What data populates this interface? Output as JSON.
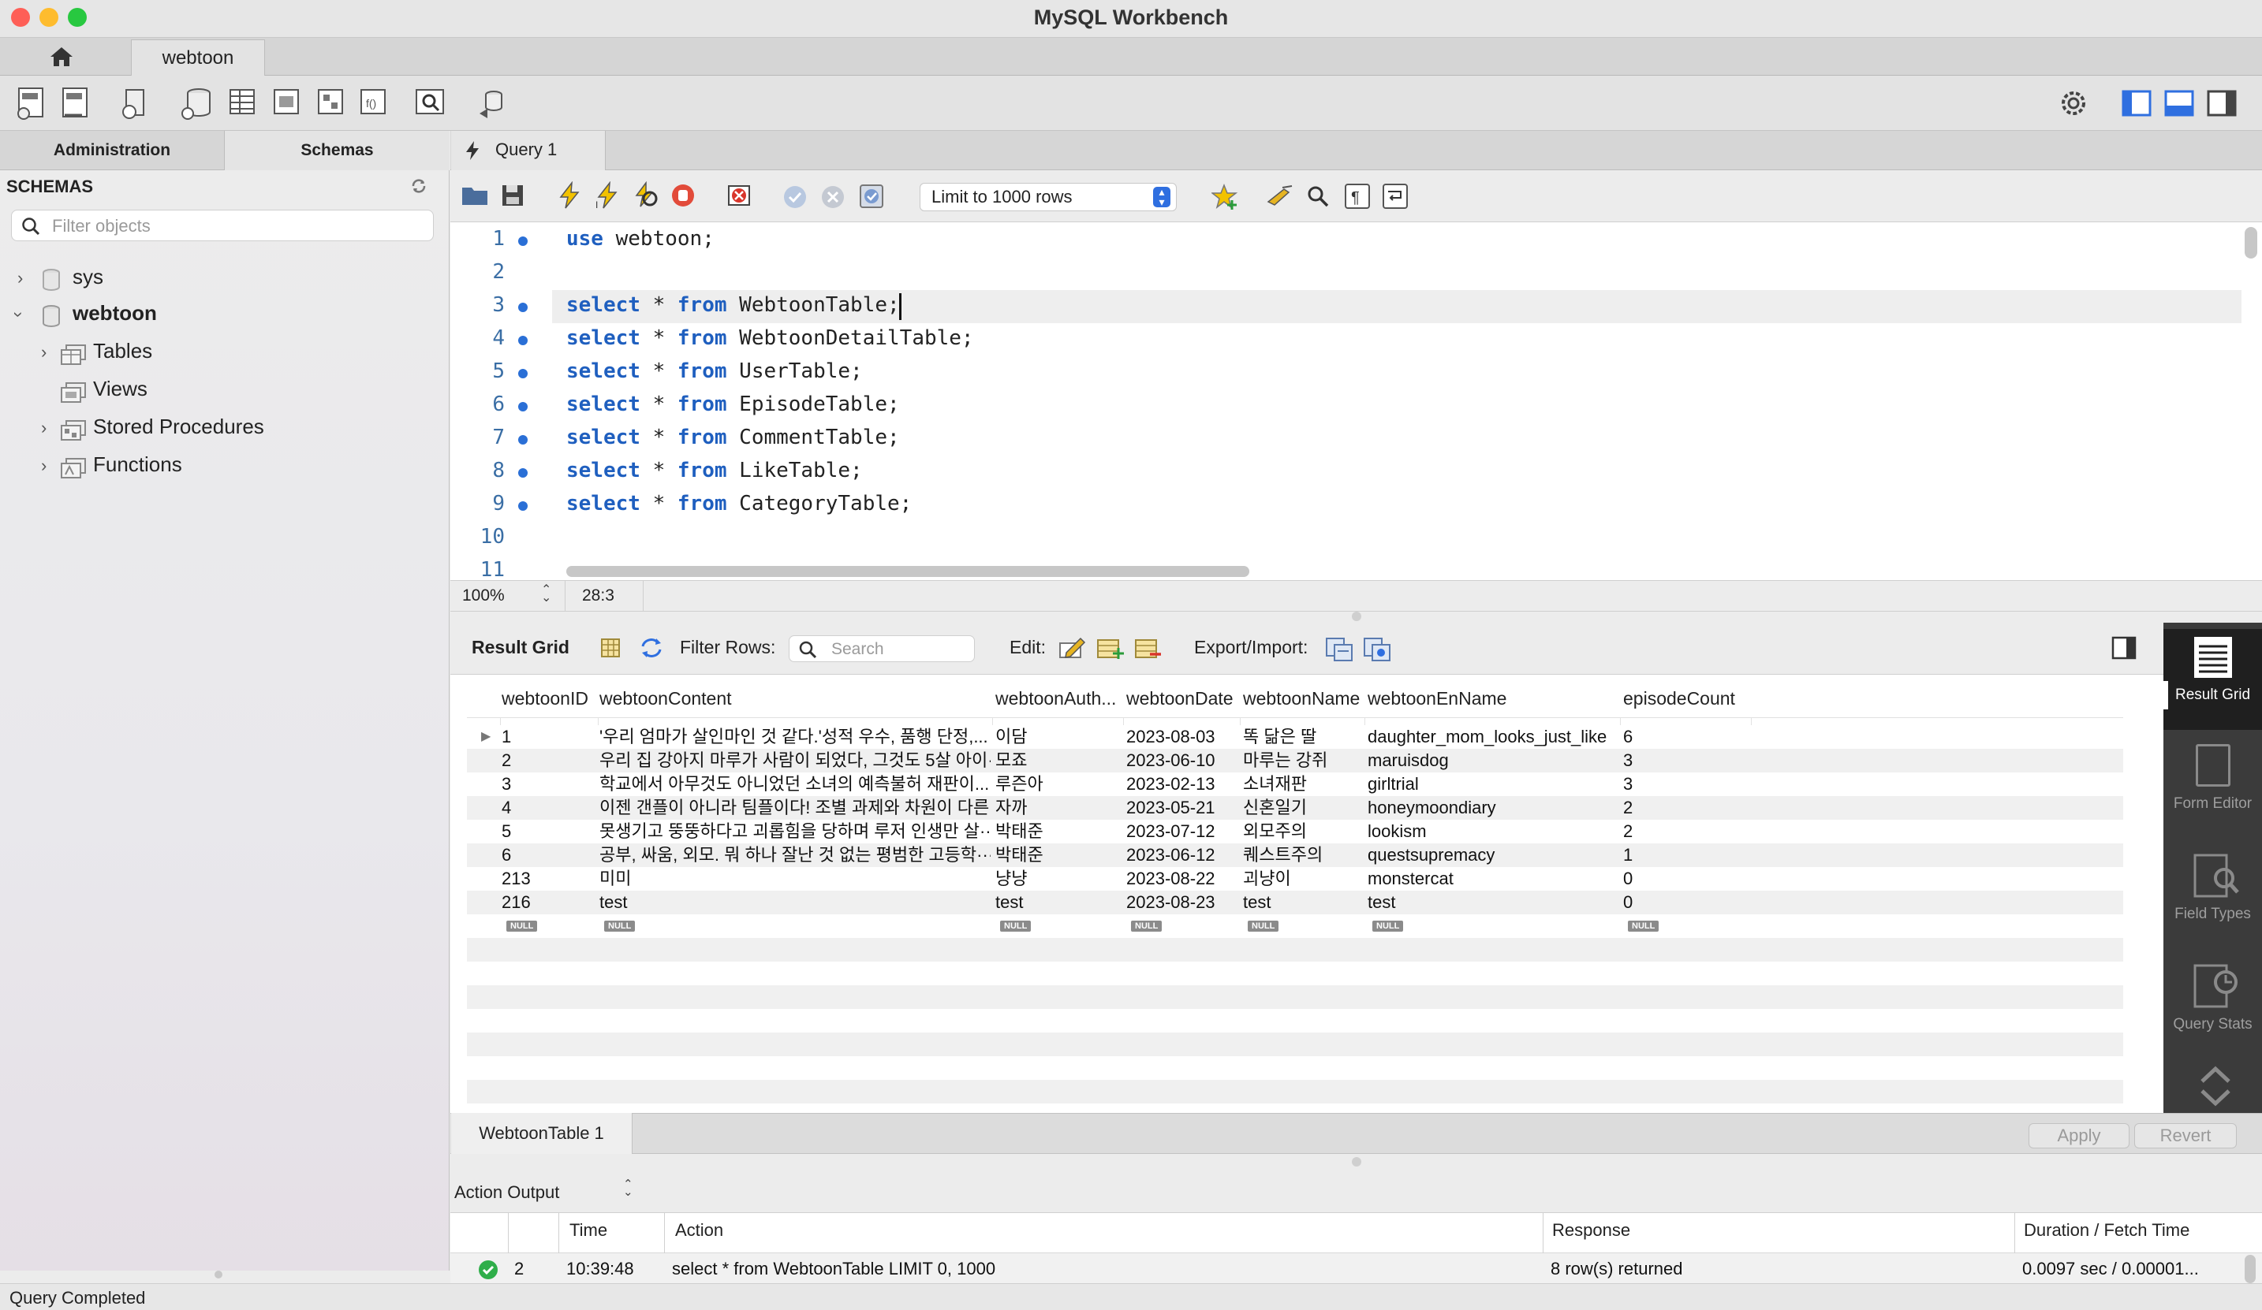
{
  "window": {
    "title": "MySQL Workbench",
    "connection_tab": "webtoon"
  },
  "sidebar": {
    "tabs": [
      "Administration",
      "Schemas"
    ],
    "header": "SCHEMAS",
    "filter_placeholder": "Filter objects",
    "tree": {
      "sys": "sys",
      "webtoon": "webtoon",
      "tables": "Tables",
      "views": "Views",
      "stored_procedures": "Stored Procedures",
      "functions": "Functions"
    }
  },
  "editor": {
    "tab": "Query 1",
    "limit": "Limit to 1000 rows",
    "zoom": "100%",
    "cursor": "28:3",
    "lines": [
      {
        "num": "1",
        "kw": "use",
        "rest": " webtoon;",
        "dot": true
      },
      {
        "num": "2",
        "kw": "",
        "rest": "",
        "dot": false
      },
      {
        "num": "3",
        "kw": "select",
        "mid": " * ",
        "kw2": "from",
        "rest": " WebtoonTable;",
        "dot": true
      },
      {
        "num": "4",
        "kw": "select",
        "mid": " * ",
        "kw2": "from",
        "rest": " WebtoonDetailTable;",
        "dot": true
      },
      {
        "num": "5",
        "kw": "select",
        "mid": " * ",
        "kw2": "from",
        "rest": " UserTable;",
        "dot": true
      },
      {
        "num": "6",
        "kw": "select",
        "mid": " * ",
        "kw2": "from",
        "rest": " EpisodeTable;",
        "dot": true
      },
      {
        "num": "7",
        "kw": "select",
        "mid": " * ",
        "kw2": "from",
        "rest": " CommentTable;",
        "dot": true
      },
      {
        "num": "8",
        "kw": "select",
        "mid": " * ",
        "kw2": "from",
        "rest": " LikeTable;",
        "dot": true
      },
      {
        "num": "9",
        "kw": "select",
        "mid": " * ",
        "kw2": "from",
        "rest": " CategoryTable;",
        "dot": true
      },
      {
        "num": "10",
        "kw": "",
        "rest": "",
        "dot": false
      },
      {
        "num": "11",
        "kw": "",
        "rest": "",
        "dot": false
      }
    ]
  },
  "result": {
    "label": "Result Grid",
    "filter_label": "Filter Rows:",
    "search_placeholder": "Search",
    "edit_label": "Edit:",
    "export_label": "Export/Import:",
    "columns": [
      "webtoonID",
      "webtoonContent",
      "webtoonAuth...",
      "webtoonDate",
      "webtoonName",
      "webtoonEnName",
      "episodeCount"
    ],
    "rows": [
      [
        "1",
        "'우리 엄마가 살인마인 것 같다.'성적 우수, 품행 단정,...",
        "이담",
        "2023-08-03",
        "똑 닮은 딸",
        "daughter_mom_looks_just_like",
        "6"
      ],
      [
        "2",
        "우리 집 강아지 마루가 사람이 되었다, 그것도 5살 아이···",
        "모죠",
        "2023-06-10",
        "마루는 강쥐",
        "maruisdog",
        "3"
      ],
      [
        "3",
        "학교에서 아무것도 아니었던 소녀의 예측불허 재판이...",
        "루즌아",
        "2023-02-13",
        "소녀재판",
        "girltrial",
        "3"
      ],
      [
        "4",
        "이젠 갠플이 아니라 팀플이다! 조별 과제와 차원이 다른...",
        "자까",
        "2023-05-21",
        "신혼일기",
        "honeymoondiary",
        "2"
      ],
      [
        "5",
        "못생기고 뚱뚱하다고 괴롭힘을 당하며 루저 인생만 살···",
        "박태준",
        "2023-07-12",
        "외모주의",
        "lookism",
        "2"
      ],
      [
        "6",
        "공부, 싸움, 외모. 뭐 하나 잘난 것 없는 평범한 고등학···",
        "박태준",
        "2023-06-12",
        "퀘스트주의",
        "questsupremacy",
        "1"
      ],
      [
        "213",
        "미미",
        "냥냥",
        "2023-08-22",
        "괴냥이",
        "monstercat",
        "0"
      ],
      [
        "216",
        "test",
        "test",
        "2023-08-23",
        "test",
        "test",
        "0"
      ]
    ],
    "null_label": "NULL",
    "side_panel": [
      "Result Grid",
      "Form Editor",
      "Field Types",
      "Query Stats"
    ],
    "bottom_tab": "WebtoonTable 1",
    "apply": "Apply",
    "revert": "Revert"
  },
  "output": {
    "selector": "Action Output",
    "columns": [
      "Time",
      "Action",
      "Response",
      "Duration / Fetch Time"
    ],
    "row": {
      "num": "2",
      "time": "10:39:48",
      "action": "select * from WebtoonTable LIMIT 0, 1000",
      "response": "8 row(s) returned",
      "duration": "0.0097 sec / 0.00001..."
    }
  },
  "status": "Query Completed",
  "colors": {
    "accent": "#2f6fe0",
    "keyword": "#1f5fbf",
    "ok": "#2fae4a"
  }
}
